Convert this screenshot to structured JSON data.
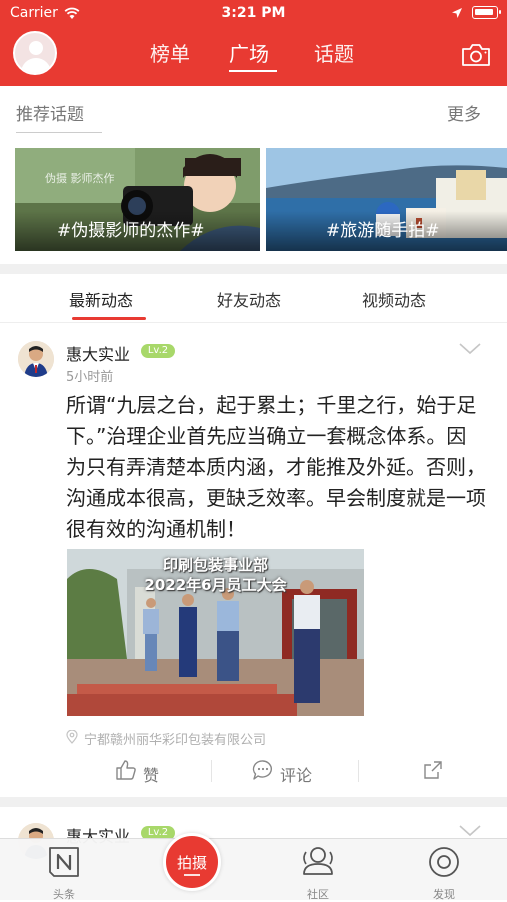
{
  "status_bar": {
    "carrier": "Carrier",
    "time": "3:21 PM"
  },
  "header": {
    "tabs": [
      {
        "label": "榜单",
        "active": false
      },
      {
        "label": "广场",
        "active": true
      },
      {
        "label": "话题",
        "active": false
      }
    ],
    "accent_color": "#e83a32"
  },
  "recommend": {
    "title": "推荐话题",
    "more_label": "更多",
    "topics": [
      {
        "caption": "#伪摄影师的杰作#",
        "watermark": "伪摄 影师杰作"
      },
      {
        "caption": "#旅游随手拍#"
      }
    ]
  },
  "feed_tabs": [
    {
      "label": "最新动态",
      "active": true
    },
    {
      "label": "好友动态",
      "active": false
    },
    {
      "label": "视频动态",
      "active": false
    }
  ],
  "post": {
    "author": "惠大实业",
    "level": "Lv.2",
    "time": "5小时前",
    "text": "所谓“九层之台，起于累土；千里之行，始于足下。”治理企业首先应当确立一套概念体系。因为只有弄清楚本质内涵，才能推及外延。否则，沟通成本很高，更缺乏效率。早会制度就是一项很有效的沟通机制！",
    "image_overlay_line1": "印刷包装事业部",
    "image_overlay_line2": "2022年6月员工大会",
    "location": "宁都赣州丽华彩印包装有限公司",
    "actions": {
      "like": "赞",
      "comment": "评论"
    }
  },
  "post2": {
    "author": "惠大实业",
    "level": "Lv.2"
  },
  "tabbar": {
    "items": [
      {
        "label": "头条",
        "icon": "news-icon"
      },
      {
        "label": "拍摄",
        "icon": "shoot-button"
      },
      {
        "label": "社区",
        "icon": "community-icon"
      },
      {
        "label": "发现",
        "icon": "discover-icon"
      }
    ]
  }
}
